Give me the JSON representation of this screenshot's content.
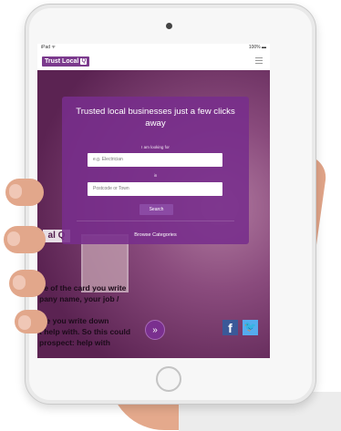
{
  "status": {
    "left": "iPad ᯤ",
    "right": "100% ▬"
  },
  "navbar": {
    "logo_text": "Trust Local",
    "logo_mark": "Q"
  },
  "hero": {
    "headline": "Trusted local businesses just a few clicks away",
    "looking_label": "I am looking for",
    "looking_placeholder": "e.g. Electrician",
    "in_label": "in",
    "location_placeholder": "Postcode or Town",
    "search_label": "Search",
    "browse_label": "Browse Categories"
  },
  "background": {
    "logo_fragment": "al Q",
    "lines": [
      "de of the card you write",
      "pany name, your job /",
      "",
      "ide you write down",
      "t help with.  So this could",
      "prospect: help with"
    ]
  },
  "footer": {
    "down_icon": "»",
    "facebook": "f",
    "twitter": "🐦"
  },
  "colors": {
    "brand": "#7b3a8d",
    "panel": "#782d8c",
    "facebook": "#3b5998",
    "twitter": "#55acee"
  }
}
